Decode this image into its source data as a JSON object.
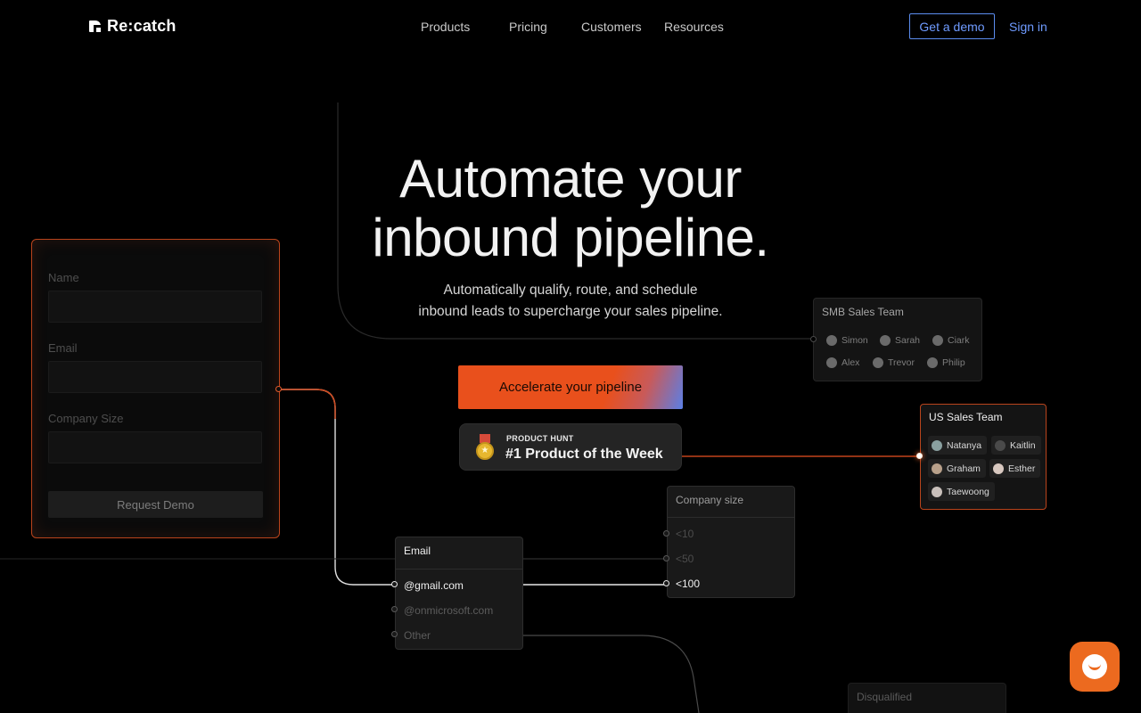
{
  "nav": {
    "brand": "Re:catch",
    "links": [
      "Products",
      "Pricing",
      "Customers",
      "Resources"
    ],
    "demo_button": "Get a demo",
    "signin": "Sign in"
  },
  "hero": {
    "title_line1": "Automate your",
    "title_line2": "inbound pipeline.",
    "subtitle_line1": "Automatically qualify, route, and schedule",
    "subtitle_line2": "inbound leads to supercharge your sales pipeline.",
    "cta": "Accelerate your pipeline"
  },
  "product_hunt": {
    "kicker": "PRODUCT HUNT",
    "title": "#1 Product of the Week"
  },
  "form_card": {
    "fields": [
      "Name",
      "Email",
      "Company Size"
    ],
    "button": "Request Demo"
  },
  "email_node": {
    "title": "Email",
    "options": [
      "@gmail.com",
      "@onmicrosoft.com",
      "Other"
    ]
  },
  "company_node": {
    "title": "Company size",
    "options": [
      "<10",
      "<50",
      "<100"
    ]
  },
  "smb_team": {
    "title": "SMB Sales Team",
    "members": [
      "Simon",
      "Sarah",
      "Ciark",
      "Alex",
      "Trevor",
      "Philip"
    ]
  },
  "us_team": {
    "title": "US Sales Team",
    "members": [
      "Natanya",
      "Kaitlin",
      "Graham",
      "Esther",
      "Taewoong"
    ]
  },
  "disqualified": {
    "title": "Disqualified"
  },
  "colors": {
    "accent_orange": "#e9501c",
    "link_blue": "#6f9bff",
    "chat_orange": "#ec6a1f"
  }
}
